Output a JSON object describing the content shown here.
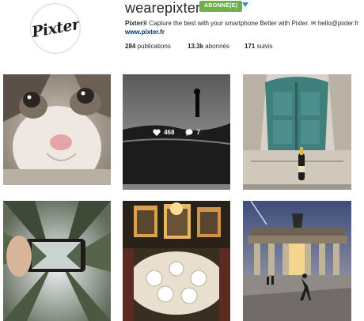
{
  "profile": {
    "avatar_logo": "Pixter",
    "username": "wearepixter",
    "follow_label": "ABONNÉ(E)",
    "bio_name": "Pixter®",
    "bio_text": " Capture the best with your smartphone  Better with Pixter. ✉ hello@pixter.fr ",
    "bio_link": "www.pixter.fr"
  },
  "stats": {
    "posts_count": "284",
    "posts_label": "publications",
    "followers_count": "13.3k",
    "followers_label": "abonnés",
    "following_count": "171",
    "following_label": "suivis"
  },
  "hovered_post": {
    "likes": "468",
    "comments": "7"
  },
  "colors": {
    "follow_green": "#70b04a",
    "link_blue": "#003569",
    "dropdown_blue": "#3d87d6"
  }
}
